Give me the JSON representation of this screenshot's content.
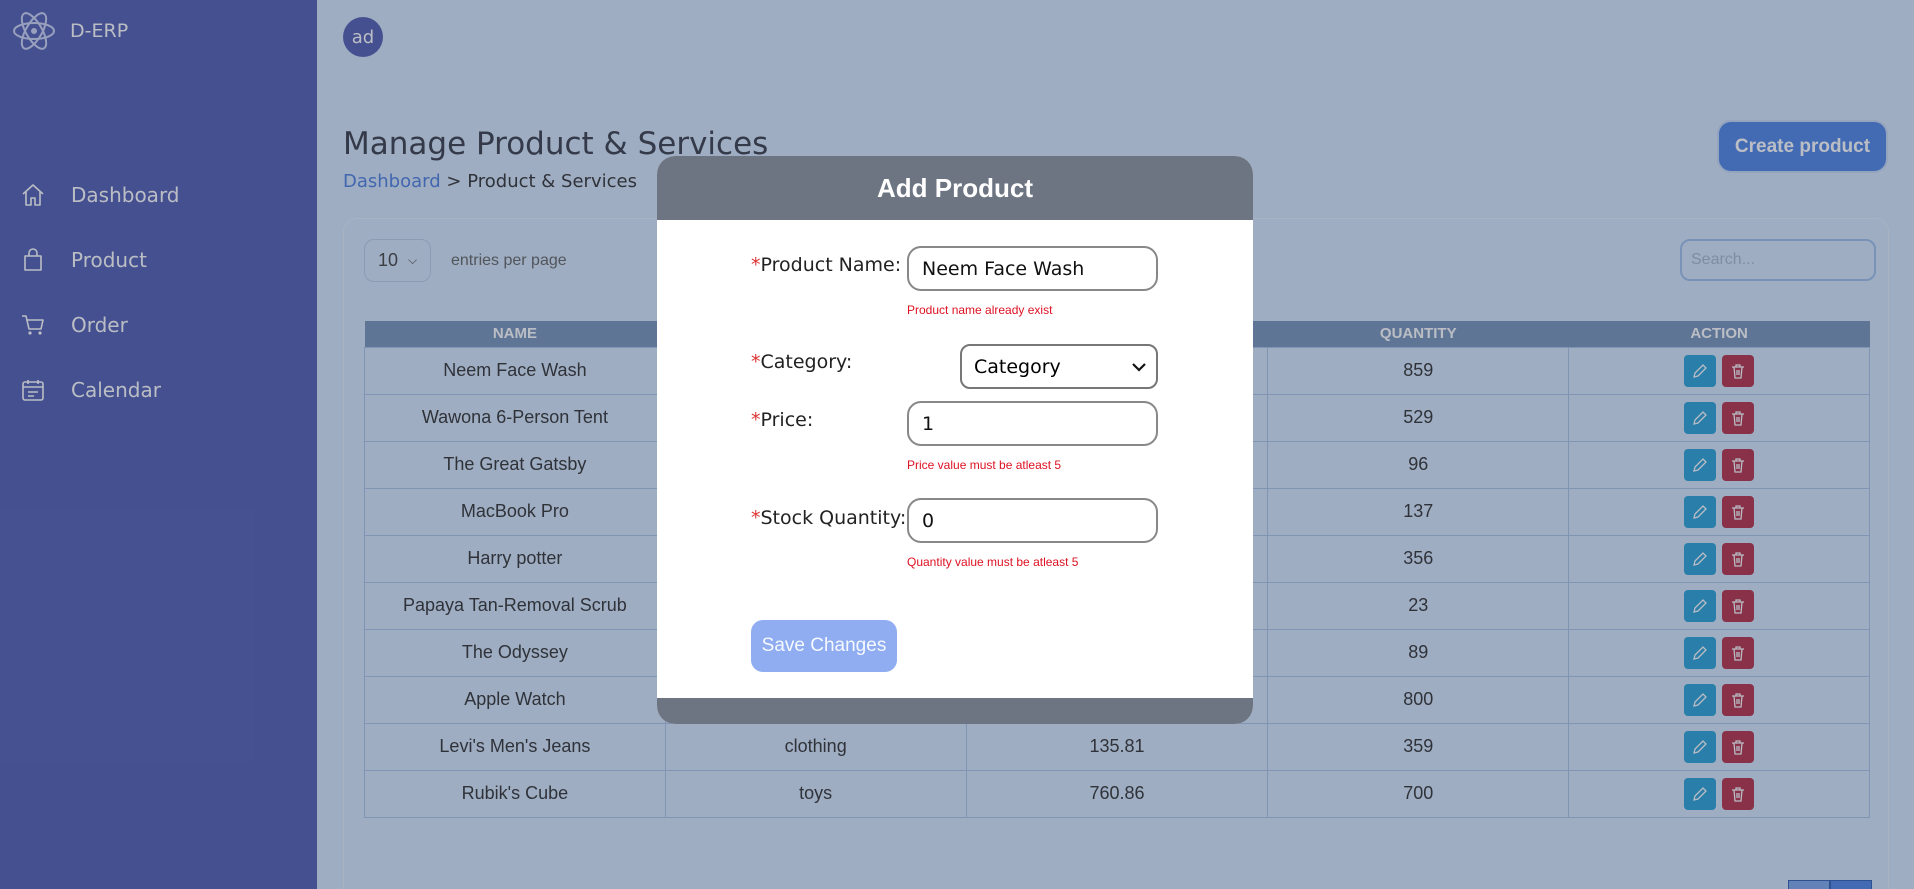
{
  "app": {
    "name": "D-ERP"
  },
  "sidebar": {
    "items": [
      {
        "label": "Dashboard",
        "icon": "home-icon"
      },
      {
        "label": "Product",
        "icon": "shopping-bag-icon"
      },
      {
        "label": "Order",
        "icon": "cart-icon"
      },
      {
        "label": "Calendar",
        "icon": "calendar-icon"
      }
    ]
  },
  "header": {
    "avatar_text": "ad"
  },
  "page": {
    "title": "Manage Product & Services",
    "breadcrumb": {
      "link": "Dashboard",
      "separator": ">",
      "current": "Product & Services"
    },
    "create_button": "Create product"
  },
  "table": {
    "entries_value": "10",
    "entries_label": "entries per page",
    "search_placeholder": "Search...",
    "columns": [
      "NAME",
      "",
      "",
      "QUANTITY",
      "ACTION"
    ],
    "rows": [
      {
        "name": "Neem Face Wash",
        "category": "",
        "price": "",
        "quantity": "859"
      },
      {
        "name": "Wawona 6-Person Tent",
        "category": "",
        "price": "",
        "quantity": "529"
      },
      {
        "name": "The Great Gatsby",
        "category": "",
        "price": "",
        "quantity": "96"
      },
      {
        "name": "MacBook Pro",
        "category": "",
        "price": "",
        "quantity": "137"
      },
      {
        "name": "Harry potter",
        "category": "",
        "price": "",
        "quantity": "356"
      },
      {
        "name": "Papaya Tan-Removal Scrub",
        "category": "",
        "price": "",
        "quantity": "23"
      },
      {
        "name": "The Odyssey",
        "category": "",
        "price": "",
        "quantity": "89"
      },
      {
        "name": "Apple Watch",
        "category": "",
        "price": "",
        "quantity": "800"
      },
      {
        "name": "Levi's Men's Jeans",
        "category": "clothing",
        "price": "135.81",
        "quantity": "359"
      },
      {
        "name": "Rubik's Cube",
        "category": "toys",
        "price": "760.86",
        "quantity": "700"
      }
    ]
  },
  "modal": {
    "title": "Add Product",
    "required_mark": "*",
    "product_name": {
      "label": "Product Name:",
      "value": "Neem Face Wash",
      "error": "Product name already exist"
    },
    "category": {
      "label": "Category:",
      "value": "Category"
    },
    "price": {
      "label": "Price:",
      "value": "1",
      "error": "Price value must be atleast 5"
    },
    "stock": {
      "label": "Stock Quantity:",
      "value": "0",
      "error": "Quantity value must be atleast 5"
    },
    "save_button": "Save Changes"
  },
  "colors": {
    "sidebar": "#535fb3",
    "accent": "#4f86e8",
    "edit": "#2ca2d9",
    "delete": "#b5324a",
    "error": "#d12"
  }
}
